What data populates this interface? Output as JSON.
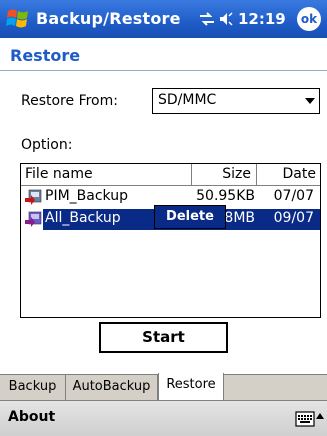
{
  "window": {
    "title": "Backup/Restore",
    "clock": "12:19",
    "ok_label": "ok"
  },
  "page": {
    "title": "Restore"
  },
  "restore_from": {
    "label": "Restore From:",
    "value": "SD/MMC"
  },
  "option_label": "Option:",
  "list": {
    "columns": [
      "File name",
      "Size",
      "Date"
    ],
    "rows": [
      {
        "name": "PIM_Backup",
        "size": "50.95KB",
        "date": "07/07",
        "icon": "pim-backup-icon"
      },
      {
        "name": "All_Backup",
        "size": "4.58MB",
        "date": "09/07",
        "icon": "all-backup-icon",
        "selected": true
      }
    ]
  },
  "context_menu": {
    "delete_label": "Delete"
  },
  "start_button": "Start",
  "tabs": [
    {
      "label": "Backup"
    },
    {
      "label": "AutoBackup"
    },
    {
      "label": "Restore",
      "active": true
    }
  ],
  "menubar": {
    "about_label": "About"
  },
  "colors": {
    "titlebar": "#1f5cc8",
    "selection": "#0a2a88",
    "accent_text": "#1f5cc8"
  }
}
